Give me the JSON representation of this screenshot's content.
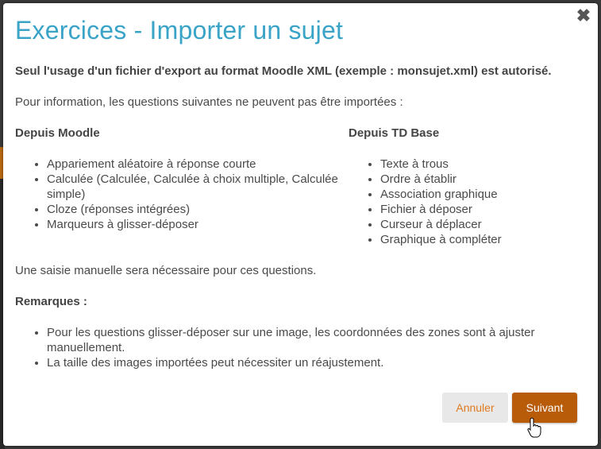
{
  "modal": {
    "title": "Exercices - Importer un sujet",
    "close_icon": "close-icon",
    "intro": "Seul l'usage d'un fichier d'export au format Moodle XML (exemple : monsujet.xml) est autorisé.",
    "info": "Pour information, les questions suivantes ne peuvent pas être importées :",
    "moodle": {
      "heading": "Depuis Moodle",
      "items": [
        "Appariement aléatoire à réponse courte",
        "Calculée (Calculée, Calculée à choix multiple, Calculée simple)",
        "Cloze (réponses intégrées)",
        "Marqueurs à glisser-déposer"
      ]
    },
    "tdbase": {
      "heading": "Depuis TD Base",
      "items": [
        "Texte à trous",
        "Ordre à établir",
        "Association graphique",
        "Fichier à déposer",
        "Curseur à déplacer",
        "Graphique à compléter"
      ]
    },
    "manual": "Une saisie manuelle sera nécessaire pour ces questions.",
    "remarks": {
      "heading": "Remarques :",
      "items": [
        "Pour les questions glisser-déposer sur une image, les coordonnées des zones sont à ajuster manuellement.",
        "La taille des images importées peut nécessiter un réajustement."
      ]
    },
    "buttons": {
      "cancel": "Annuler",
      "next": "Suivant"
    }
  },
  "colors": {
    "title": "#3aa3c8",
    "primary_button": "#b85c0a",
    "cancel_text": "#e07a20"
  }
}
